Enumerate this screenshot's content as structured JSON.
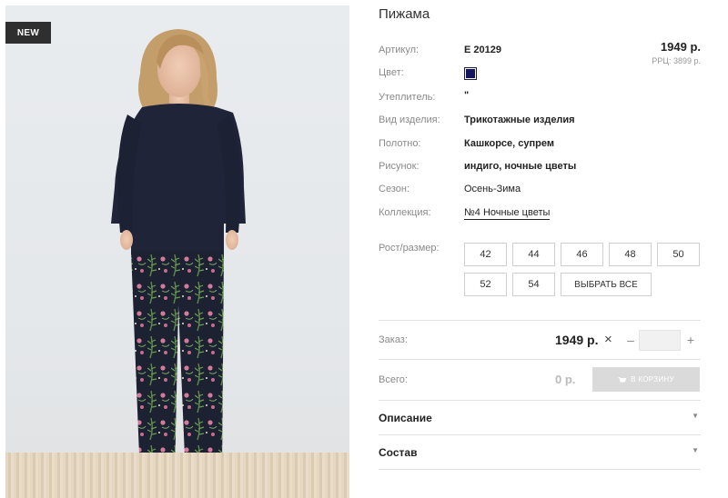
{
  "badge": "NEW",
  "product": {
    "title": "Пижама",
    "price": "1949 р.",
    "rrc": "РРЦ: 3899 р."
  },
  "attributes": {
    "article_label": "Артикул:",
    "article_value": "E 20129",
    "color_label": "Цвет:",
    "color_hex": "#14145c",
    "insulation_label": "Утеплитель:",
    "insulation_value": "\"",
    "type_label": "Вид изделия:",
    "type_value": "Трикотажные изделия",
    "fabric_label": "Полотно:",
    "fabric_value": "Кашкорсе, супрем",
    "pattern_label": "Рисунок:",
    "pattern_value": "индиго, ночные цветы",
    "season_label": "Сезон:",
    "season_value": "Осень-Зима",
    "collection_label": "Коллекция:",
    "collection_value": "№4 Ночные цветы"
  },
  "sizes": {
    "label": "Рост/размер:",
    "options": [
      "42",
      "44",
      "46",
      "48",
      "50",
      "52",
      "54"
    ],
    "select_all": "ВЫБРАТЬ ВСЕ"
  },
  "order": {
    "label": "Заказ:",
    "price": "1949 р.",
    "minus": "–",
    "plus": "+",
    "quantity_value": ""
  },
  "total": {
    "label": "Всего:",
    "value": "0 р.",
    "cart_button": "В КОРЗИНУ"
  },
  "accordion": {
    "description": "Описание",
    "composition": "Состав"
  }
}
